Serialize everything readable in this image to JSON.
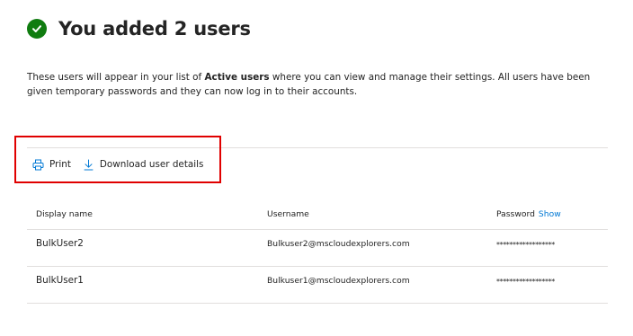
{
  "header": {
    "title": "You added 2 users"
  },
  "description": {
    "prefix": "These users will appear in your list of ",
    "bold": "Active users",
    "suffix": " where you can view and manage their settings. All users have been given temporary passwords and they can now log in to their accounts."
  },
  "toolbar": {
    "print_label": "Print",
    "download_label": "Download user details"
  },
  "table": {
    "columns": {
      "display_name": "Display name",
      "username": "Username",
      "password": "Password",
      "show_label": "Show"
    },
    "rows": [
      {
        "display_name": "BulkUser2",
        "username": "Bulkuser2@mscloudexplorers.com",
        "password": "******************"
      },
      {
        "display_name": "BulkUser1",
        "username": "Bulkuser1@mscloudexplorers.com",
        "password": "******************"
      }
    ]
  },
  "colors": {
    "success": "#107c10",
    "link": "#0078d4",
    "highlight": "#e00000"
  }
}
